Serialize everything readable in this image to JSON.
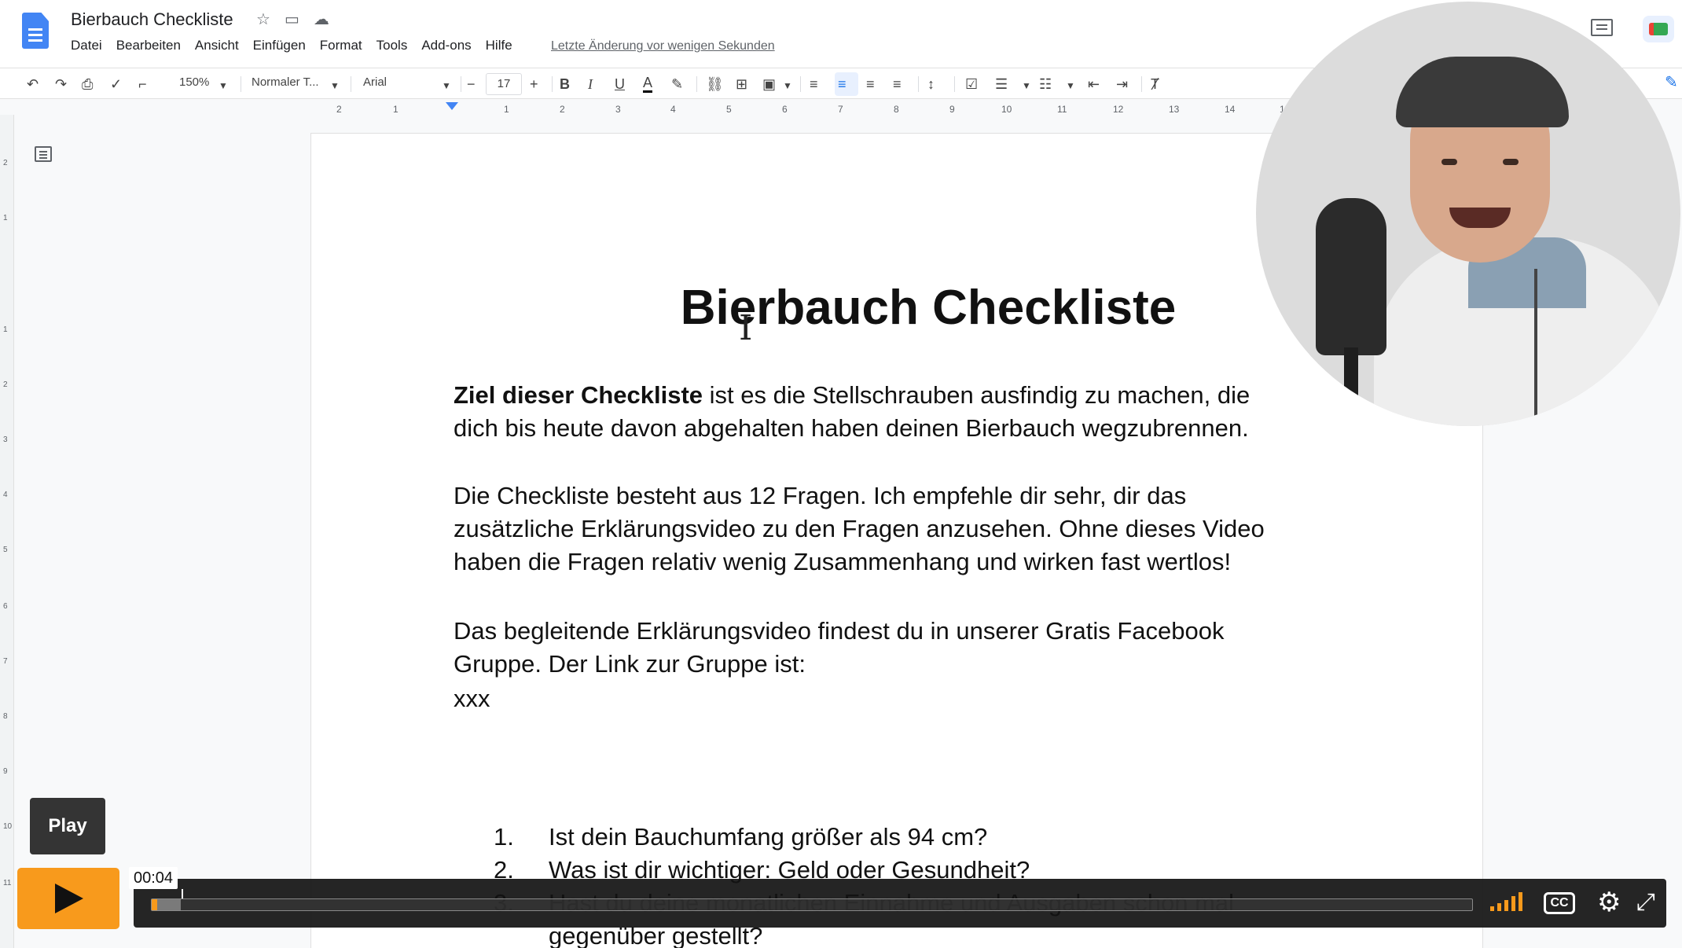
{
  "app": {
    "doc_title": "Bierbauch Checkliste",
    "menu": [
      "Datei",
      "Bearbeiten",
      "Ansicht",
      "Einfügen",
      "Format",
      "Tools",
      "Add-ons",
      "Hilfe"
    ],
    "last_edit": "Letzte Änderung vor wenigen Sekunden"
  },
  "toolbar": {
    "zoom": "150%",
    "style": "Normaler T...",
    "font": "Arial",
    "font_size": "17",
    "bold": "B",
    "italic": "I",
    "underline": "U",
    "text_color": "A"
  },
  "ruler": {
    "h_ticks": [
      "2",
      "1",
      "1",
      "2",
      "3",
      "4",
      "5",
      "6",
      "7",
      "8",
      "9",
      "10",
      "11",
      "12",
      "13",
      "14",
      "1"
    ],
    "v_ticks": [
      "2",
      "1",
      "1",
      "2",
      "3",
      "4",
      "5",
      "6",
      "7",
      "8",
      "9",
      "10",
      "11"
    ]
  },
  "document": {
    "heading": "Bierbauch Checkliste",
    "p1_bold": "Ziel dieser Checkliste",
    "p1_rest": " ist es die Stellschrauben ausfindig zu machen, die dich bis heute davon abgehalten haben deinen Bierbauch wegzubrennen.",
    "p2": "Die Checkliste besteht aus 12 Fragen. Ich empfehle dir sehr, dir das zusätzliche Erklärungsvideo zu den Fragen anzusehen. Ohne dieses Video haben die Fragen relativ wenig Zusammenhang und wirken fast wertlos!",
    "p3": "Das begleitende Erklärungsvideo findest du in unserer Gratis Facebook Gruppe. Der Link zur Gruppe ist:",
    "p4": "xxx",
    "list": [
      {
        "num": "1.",
        "text": "Ist dein Bauchumfang größer als 94 cm?"
      },
      {
        "num": "2.",
        "text": "Was ist dir wichtiger: Geld oder Gesundheit?"
      },
      {
        "num": "3.",
        "text": "Hast du deine monatlichen Einnahme und Ausgaben schon mal gegenüber gestellt?"
      }
    ]
  },
  "player": {
    "play_tooltip": "Play",
    "time": "00:04",
    "cc_label": "CC",
    "progress_played": 0.004,
    "progress_buffered": 0.022,
    "accent_color": "#f89a1c"
  }
}
